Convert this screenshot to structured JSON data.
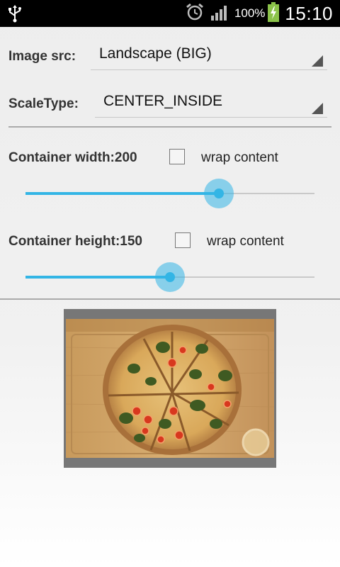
{
  "status_bar": {
    "usb_icon": "usb-icon",
    "alarm_icon": "alarm-clock-icon",
    "signal_icon": "cell-signal-icon",
    "battery_percent": "100%",
    "battery_icon": "battery-charging-icon",
    "time": "15:10"
  },
  "image_src": {
    "label": "Image src:",
    "value": "Landscape (BIG)"
  },
  "scale_type": {
    "label": "ScaleType:",
    "value": "CENTER_INSIDE"
  },
  "width": {
    "label": "Container width:200",
    "wrap_label": "wrap content",
    "wrap_checked": false,
    "slider_fraction": 0.67
  },
  "height": {
    "label": "Container height:150",
    "wrap_label": "wrap content",
    "wrap_checked": false,
    "slider_fraction": 0.5
  },
  "colors": {
    "accent": "#33b5e5",
    "container": "#777777"
  }
}
